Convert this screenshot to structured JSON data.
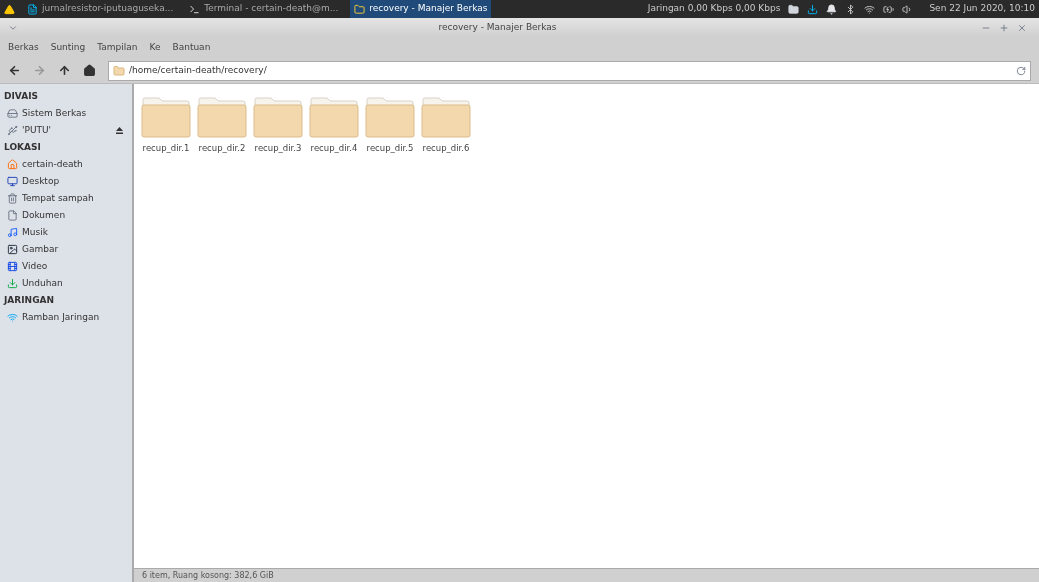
{
  "taskbar": {
    "tasks": [
      {
        "label": "jurnalresistor-iputuaguseka...",
        "kind": "document",
        "selected": false
      },
      {
        "label": "Terminal - certain-death@m...",
        "kind": "terminal",
        "selected": false
      },
      {
        "label": "recovery - Manajer Berkas",
        "kind": "folder",
        "selected": true
      }
    ],
    "network": "Jaringan 0,00 Kbps 0,00 Kbps",
    "clock": "Sen 22 Jun 2020, 10:10"
  },
  "window": {
    "title": "recovery - Manajer Berkas"
  },
  "menu": [
    "Berkas",
    "Sunting",
    "Tampilan",
    "Ke",
    "Bantuan"
  ],
  "location": {
    "value": "/home/certain-death/recovery/"
  },
  "sidebar": [
    {
      "heading": "DIVAIS",
      "items": [
        {
          "label": "Sistem Berkas",
          "kind": "drive",
          "ejectable": false
        },
        {
          "label": "'PUTU'",
          "kind": "usb",
          "ejectable": true
        }
      ]
    },
    {
      "heading": "LOKASI",
      "items": [
        {
          "label": "certain-death",
          "kind": "home",
          "ejectable": false
        },
        {
          "label": "Desktop",
          "kind": "desktop",
          "ejectable": false
        },
        {
          "label": "Tempat sampah",
          "kind": "trash",
          "ejectable": false
        },
        {
          "label": "Dokumen",
          "kind": "document",
          "ejectable": false
        },
        {
          "label": "Musik",
          "kind": "music",
          "ejectable": false
        },
        {
          "label": "Gambar",
          "kind": "image",
          "ejectable": false
        },
        {
          "label": "Video",
          "kind": "video",
          "ejectable": false
        },
        {
          "label": "Unduhan",
          "kind": "download",
          "ejectable": false
        }
      ]
    },
    {
      "heading": "JARINGAN",
      "items": [
        {
          "label": "Ramban Jaringan",
          "kind": "network",
          "ejectable": false
        }
      ]
    }
  ],
  "files": [
    {
      "name": "recup_dir.1"
    },
    {
      "name": "recup_dir.2"
    },
    {
      "name": "recup_dir.3"
    },
    {
      "name": "recup_dir.4"
    },
    {
      "name": "recup_dir.5"
    },
    {
      "name": "recup_dir.6"
    }
  ],
  "status_bar": "6 item, Ruang kosong: 382,6 GiB"
}
